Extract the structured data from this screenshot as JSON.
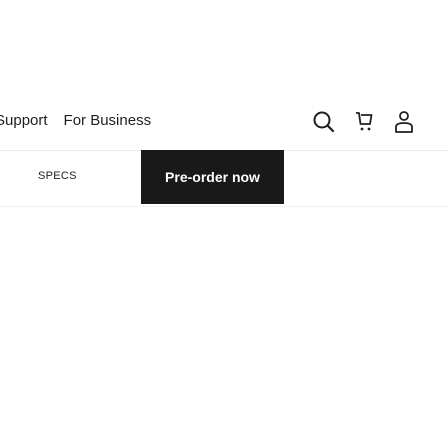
{
  "nav": {
    "links": {
      "support": "Support",
      "business": "For Business"
    },
    "icons": {
      "search": "search-icon",
      "cart": "cart-icon",
      "account": "account-icon"
    }
  },
  "subbar": {
    "specs_label": "SPECS",
    "preorder_label": "Pre-order now"
  },
  "colors": {
    "button_bg": "#191919",
    "button_text": "#ffffff",
    "text": "#1f1f1f"
  }
}
